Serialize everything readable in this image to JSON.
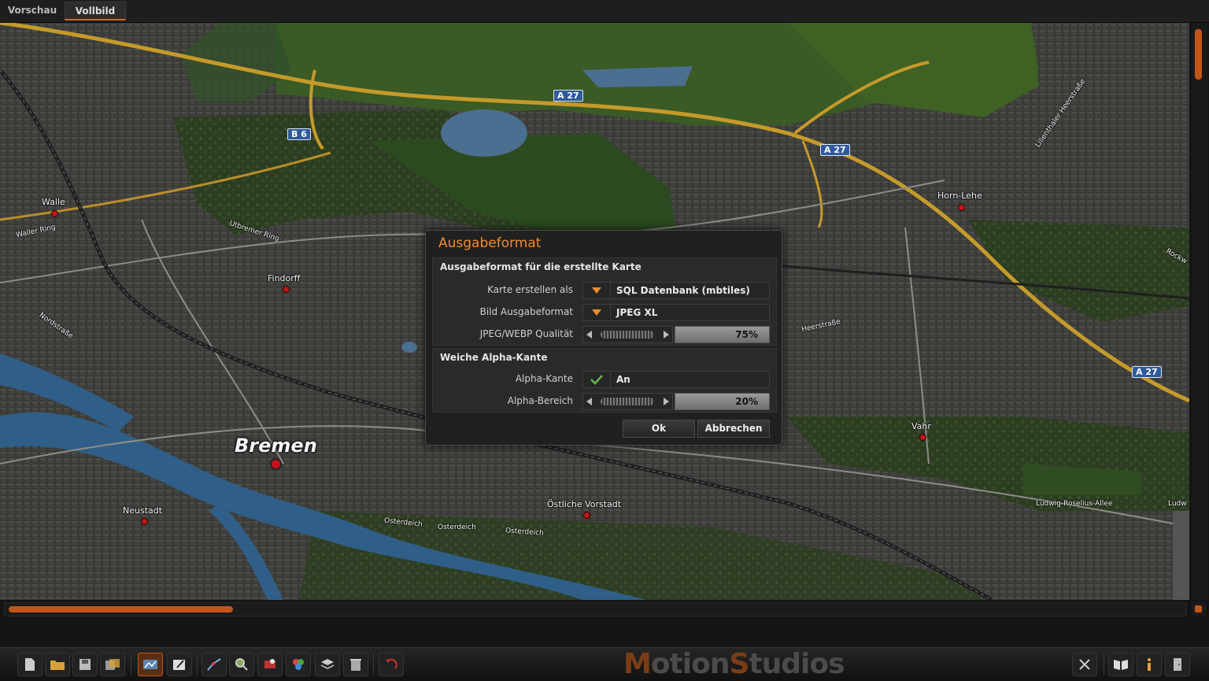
{
  "tabs": [
    {
      "label": "Vorschau",
      "active": false
    },
    {
      "label": "Vollbild",
      "active": true
    }
  ],
  "map": {
    "labels": {
      "bremen": "Bremen",
      "walle": "Walle",
      "findorff": "Findorff",
      "neustadt": "Neustadt",
      "horn_lehe": "Horn-Lehe",
      "vahr": "Vahr",
      "oestliche_vorstadt": "Östliche Vorstadt",
      "waller_ring": "Waller Ring",
      "nordstrasse": "Nordstraße",
      "utbremer_ring": "Utbremer Ring",
      "osterdeich_1": "Osterdeich",
      "osterdeich_2": "Osterdeich",
      "osterdeich_3": "Osterdeich",
      "ludwig_roselius": "Ludwig-Roselius-Allee",
      "heerstrasse": "Heerstraße",
      "lilienthaler": "Lilienthaler Heerstraße",
      "rockw": "Rockw",
      "ludw": "Ludw"
    },
    "shields": {
      "a27_top": "A 27",
      "a27_mid": "A 27",
      "a27_right": "A 27",
      "b6": "B 6"
    }
  },
  "dialog": {
    "title": "Ausgabeformat",
    "section1": {
      "title": "Ausgabeformat für die erstellte Karte",
      "karte_label": "Karte erstellen als",
      "karte_value": "SQL Datenbank (mbtiles)",
      "bild_label": "Bild Ausgabeformat",
      "bild_value": "JPEG XL",
      "quality_label": "JPEG/WEBP Qualität",
      "quality_value": "75%"
    },
    "section2": {
      "title": "Weiche Alpha-Kante",
      "kante_label": "Alpha-Kante",
      "kante_value": "An",
      "kante_checked": true,
      "bereich_label": "Alpha-Bereich",
      "bereich_value": "20%"
    },
    "ok_label": "Ok",
    "cancel_label": "Abbrechen"
  },
  "scroll": {
    "horizontal_position": 0.19
  },
  "logo": {
    "part1_acc": "M",
    "part1": "otion",
    "part2_acc": "S",
    "part2": "tudios"
  },
  "colors": {
    "accent": "#c2561a",
    "title": "#f08b2d"
  }
}
